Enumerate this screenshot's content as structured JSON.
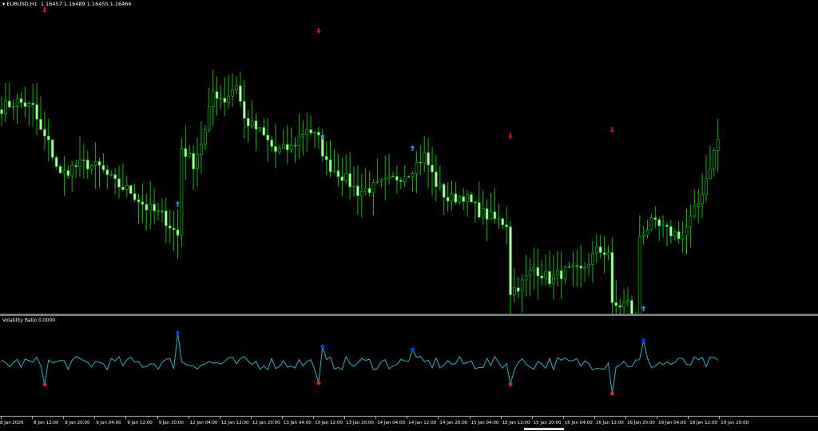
{
  "header": {
    "symbol": "EURUSD,H1",
    "ohlc": "1.16457 1.16489 1.16455 1.16466"
  },
  "indicator": {
    "title": "Volatility Ratio 0.0000"
  },
  "colors": {
    "background": "#000000",
    "candle": "#00c000",
    "bear_fill": "#c8f5c0",
    "line": "#1fb5c5",
    "buy_arrow": "#2a8cf0",
    "sell_arrow": "#e01010",
    "high_dot": "#1030ff",
    "low_dot": "#e02020"
  },
  "time_axis": [
    "8 Jan 2026",
    "8 Jan 12:00",
    "8 Jan 20:00",
    "9 Jan 04:00",
    "9 Jan 12:00",
    "9 Jan 20:00",
    "12 Jan 04:00",
    "12 Jan 12:00",
    "12 Jan 20:00",
    "13 Jan 04:00",
    "13 Jan 12:00",
    "13 Jan 20:00",
    "14 Jan 04:00",
    "14 Jan 12:00",
    "14 Jan 20:00",
    "15 Jan 04:00",
    "15 Jan 12:00",
    "15 Jan 20:00",
    "16 Jan 04:00",
    "16 Jan 12:00",
    "16 Jan 20:00",
    "19 Jan 04:00",
    "19 Jan 12:00",
    "19 Jan 20:00"
  ],
  "chart_data": {
    "type": "candlestick",
    "timeframe": "H1",
    "close_path_approx": [
      [
        0,
        1.16626
      ],
      [
        4,
        1.16658
      ],
      [
        8,
        1.16626
      ],
      [
        10,
        1.16506
      ],
      [
        12,
        1.16446
      ],
      [
        15,
        1.16286
      ],
      [
        18,
        1.16326
      ],
      [
        21,
        1.16346
      ],
      [
        25,
        1.16326
      ],
      [
        29,
        1.16246
      ],
      [
        33,
        1.16206
      ],
      [
        37,
        1.16126
      ],
      [
        41,
        1.16086
      ],
      [
        45,
        1.15986
      ],
      [
        46,
        1.16426
      ],
      [
        49,
        1.16346
      ],
      [
        52,
        1.16506
      ],
      [
        54,
        1.16706
      ],
      [
        57,
        1.16666
      ],
      [
        60,
        1.16746
      ],
      [
        62,
        1.16566
      ],
      [
        66,
        1.16506
      ],
      [
        70,
        1.16406
      ],
      [
        74,
        1.16426
      ],
      [
        78,
        1.16526
      ],
      [
        81,
        1.16466
      ],
      [
        83,
        1.16346
      ],
      [
        87,
        1.16286
      ],
      [
        91,
        1.16206
      ],
      [
        95,
        1.16226
      ],
      [
        100,
        1.16266
      ],
      [
        104,
        1.16306
      ],
      [
        108,
        1.16386
      ],
      [
        111,
        1.16246
      ],
      [
        114,
        1.16166
      ],
      [
        118,
        1.16186
      ],
      [
        122,
        1.16106
      ],
      [
        126,
        1.16066
      ],
      [
        129,
        1.16046
      ],
      [
        130,
        1.15706
      ],
      [
        133,
        1.15746
      ],
      [
        136,
        1.15826
      ],
      [
        140,
        1.15766
      ],
      [
        144,
        1.15806
      ],
      [
        148,
        1.15806
      ],
      [
        152,
        1.15906
      ],
      [
        155,
        1.15906
      ],
      [
        156,
        1.15626
      ],
      [
        160,
        1.15646
      ],
      [
        162,
        1.15506
      ],
      [
        163,
        1.15986
      ],
      [
        166,
        1.16046
      ],
      [
        170,
        1.16006
      ],
      [
        174,
        1.15986
      ],
      [
        178,
        1.16146
      ],
      [
        183,
        1.16466
      ]
    ],
    "sell_signals_bar": [
      11,
      81,
      130,
      156
    ],
    "buy_signals_bar": [
      45,
      82,
      105,
      164
    ],
    "volatility_ratio": {
      "baseline": 1.0,
      "highs": [
        [
          45,
          3.0
        ],
        [
          82,
          2.1
        ],
        [
          105,
          1.9
        ],
        [
          164,
          2.5
        ]
      ],
      "lows": [
        [
          11,
          -0.4
        ],
        [
          81,
          -0.3
        ],
        [
          130,
          -0.4
        ],
        [
          156,
          -1.0
        ]
      ],
      "current": 0.0
    }
  }
}
